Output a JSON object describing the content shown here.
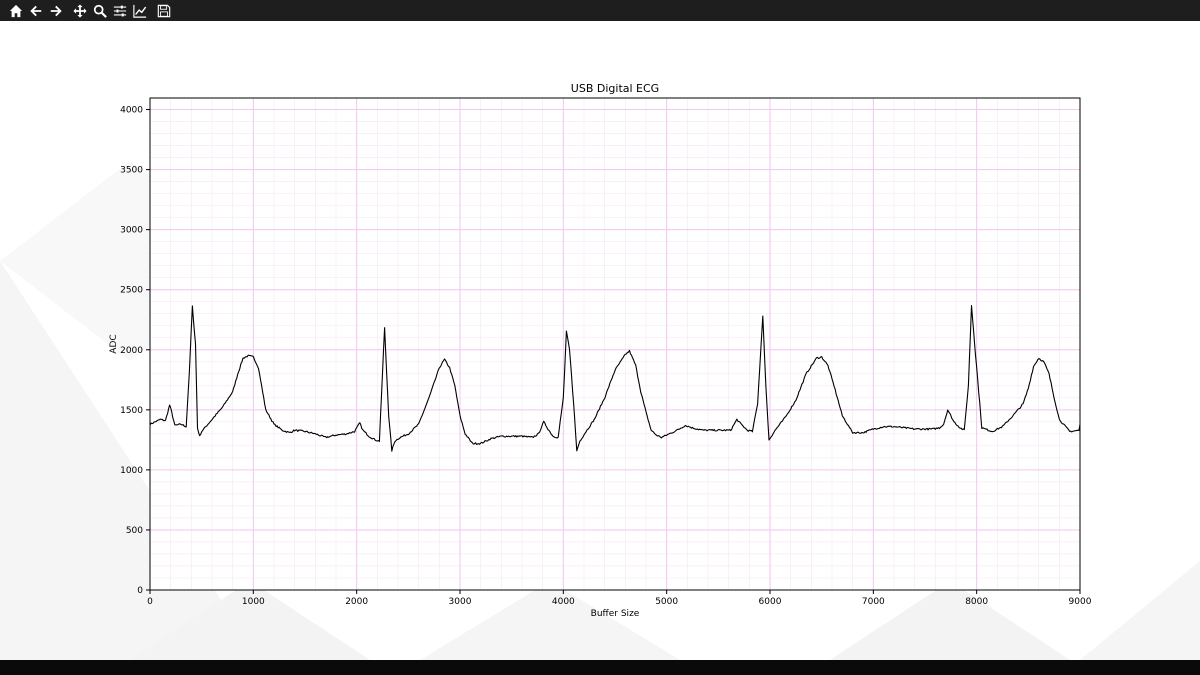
{
  "toolbar": {
    "buttons": [
      {
        "name": "home-icon"
      },
      {
        "name": "back-icon"
      },
      {
        "name": "forward-icon"
      },
      {
        "name": "pan-icon"
      },
      {
        "name": "zoom-icon"
      },
      {
        "name": "configure-subplots-icon"
      },
      {
        "name": "edit-axis-icon"
      },
      {
        "name": "save-icon"
      }
    ],
    "background": "#1e1e1e",
    "icon_color": "#ffffff"
  },
  "chart_data": {
    "type": "line",
    "title": "USB Digital ECG",
    "xlabel": "Buffer Size",
    "ylabel": "ADC",
    "xlim": [
      0,
      9000
    ],
    "ylim": [
      0,
      4096
    ],
    "x_ticks": [
      0,
      1000,
      2000,
      3000,
      4000,
      5000,
      6000,
      7000,
      8000,
      9000
    ],
    "x_tick_labels": [
      "0",
      "1000",
      "2000",
      "3000",
      "4000",
      "5000",
      "6000",
      "7000",
      "8000",
      "9000"
    ],
    "y_ticks": [
      0,
      500,
      1000,
      1500,
      2000,
      2500,
      3000,
      3500,
      4000
    ],
    "y_tick_labels": [
      "0",
      "500",
      "1000",
      "1500",
      "2000",
      "2500",
      "3000",
      "3500",
      "4000"
    ],
    "grid": true,
    "major_grid_color": "#f3c6ef",
    "minor_grid_color": "#f7e6f5",
    "line_color": "#000000",
    "series": [
      {
        "values_x": [
          0,
          100,
          150,
          190,
          210,
          240,
          300,
          350,
          380,
          410,
          440,
          460,
          480,
          500,
          530,
          600,
          700,
          800,
          850,
          900,
          950,
          1000,
          1050,
          1080,
          1120,
          1200,
          1280,
          1350,
          1400,
          1500,
          1600,
          1700,
          1800,
          1900,
          1980,
          2030,
          2060,
          2120,
          2180,
          2220,
          2270,
          2310,
          2340,
          2370,
          2420,
          2500,
          2600,
          2700,
          2800,
          2850,
          2900,
          2950,
          3000,
          3050,
          3120,
          3200,
          3300,
          3400,
          3500,
          3600,
          3700,
          3760,
          3810,
          3860,
          3900,
          3950,
          4000,
          4030,
          4060,
          4100,
          4130,
          4160,
          4220,
          4300,
          4400,
          4500,
          4600,
          4640,
          4700,
          4750,
          4800,
          4850,
          4900,
          4950,
          5000,
          5100,
          5180,
          5250,
          5350,
          5450,
          5550,
          5620,
          5680,
          5720,
          5780,
          5830,
          5880,
          5930,
          5960,
          5990,
          6050,
          6150,
          6250,
          6350,
          6450,
          6500,
          6560,
          6620,
          6700,
          6800,
          6900,
          7000,
          7100,
          7200,
          7300,
          7400,
          7500,
          7580,
          7640,
          7680,
          7720,
          7780,
          7840,
          7880,
          7920,
          7950,
          7990,
          8050,
          8150,
          8250,
          8350,
          8450,
          8500,
          8550,
          8600,
          8650,
          8700,
          8750,
          8800,
          8900,
          9000
        ],
        "values_y": [
          1380,
          1420,
          1410,
          1540,
          1480,
          1370,
          1380,
          1360,
          1800,
          2360,
          2050,
          1350,
          1280,
          1320,
          1350,
          1420,
          1520,
          1650,
          1800,
          1930,
          1950,
          1940,
          1850,
          1700,
          1500,
          1380,
          1330,
          1310,
          1330,
          1320,
          1300,
          1270,
          1290,
          1300,
          1320,
          1390,
          1330,
          1280,
          1250,
          1240,
          2180,
          1450,
          1160,
          1240,
          1270,
          1300,
          1380,
          1600,
          1850,
          1920,
          1850,
          1700,
          1450,
          1300,
          1220,
          1220,
          1260,
          1280,
          1280,
          1280,
          1270,
          1300,
          1400,
          1330,
          1280,
          1270,
          1600,
          2150,
          2000,
          1550,
          1160,
          1240,
          1320,
          1420,
          1600,
          1830,
          1960,
          1990,
          1870,
          1650,
          1480,
          1330,
          1290,
          1270,
          1290,
          1330,
          1370,
          1350,
          1330,
          1330,
          1330,
          1330,
          1420,
          1380,
          1330,
          1320,
          1550,
          2280,
          1700,
          1250,
          1330,
          1440,
          1580,
          1800,
          1930,
          1940,
          1870,
          1700,
          1450,
          1310,
          1310,
          1340,
          1360,
          1360,
          1350,
          1340,
          1340,
          1340,
          1350,
          1380,
          1500,
          1400,
          1350,
          1330,
          1700,
          2370,
          1950,
          1350,
          1320,
          1360,
          1450,
          1550,
          1680,
          1860,
          1930,
          1900,
          1800,
          1600,
          1420,
          1320,
          1330,
          1340,
          1380
        ]
      }
    ]
  }
}
